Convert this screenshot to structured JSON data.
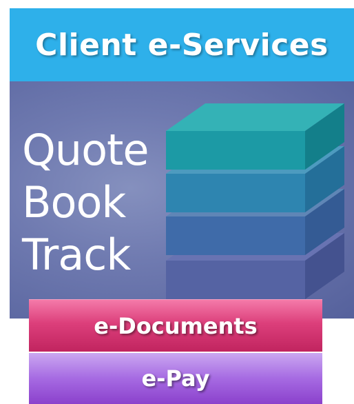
{
  "header": {
    "title": "Client e-Services"
  },
  "panel": {
    "words": [
      "Quote",
      "Book",
      "Track"
    ],
    "layer_colors": [
      "#1e9aa6",
      "#2a86ad",
      "#3c6ea8",
      "#5266a6"
    ]
  },
  "buttons": {
    "documents_label": "e-Documents",
    "pay_label": "e-Pay"
  },
  "colors": {
    "header_bg": "#2eb0ea",
    "documents_bg": "#d8346f",
    "pay_bg": "#9e5ddc"
  }
}
